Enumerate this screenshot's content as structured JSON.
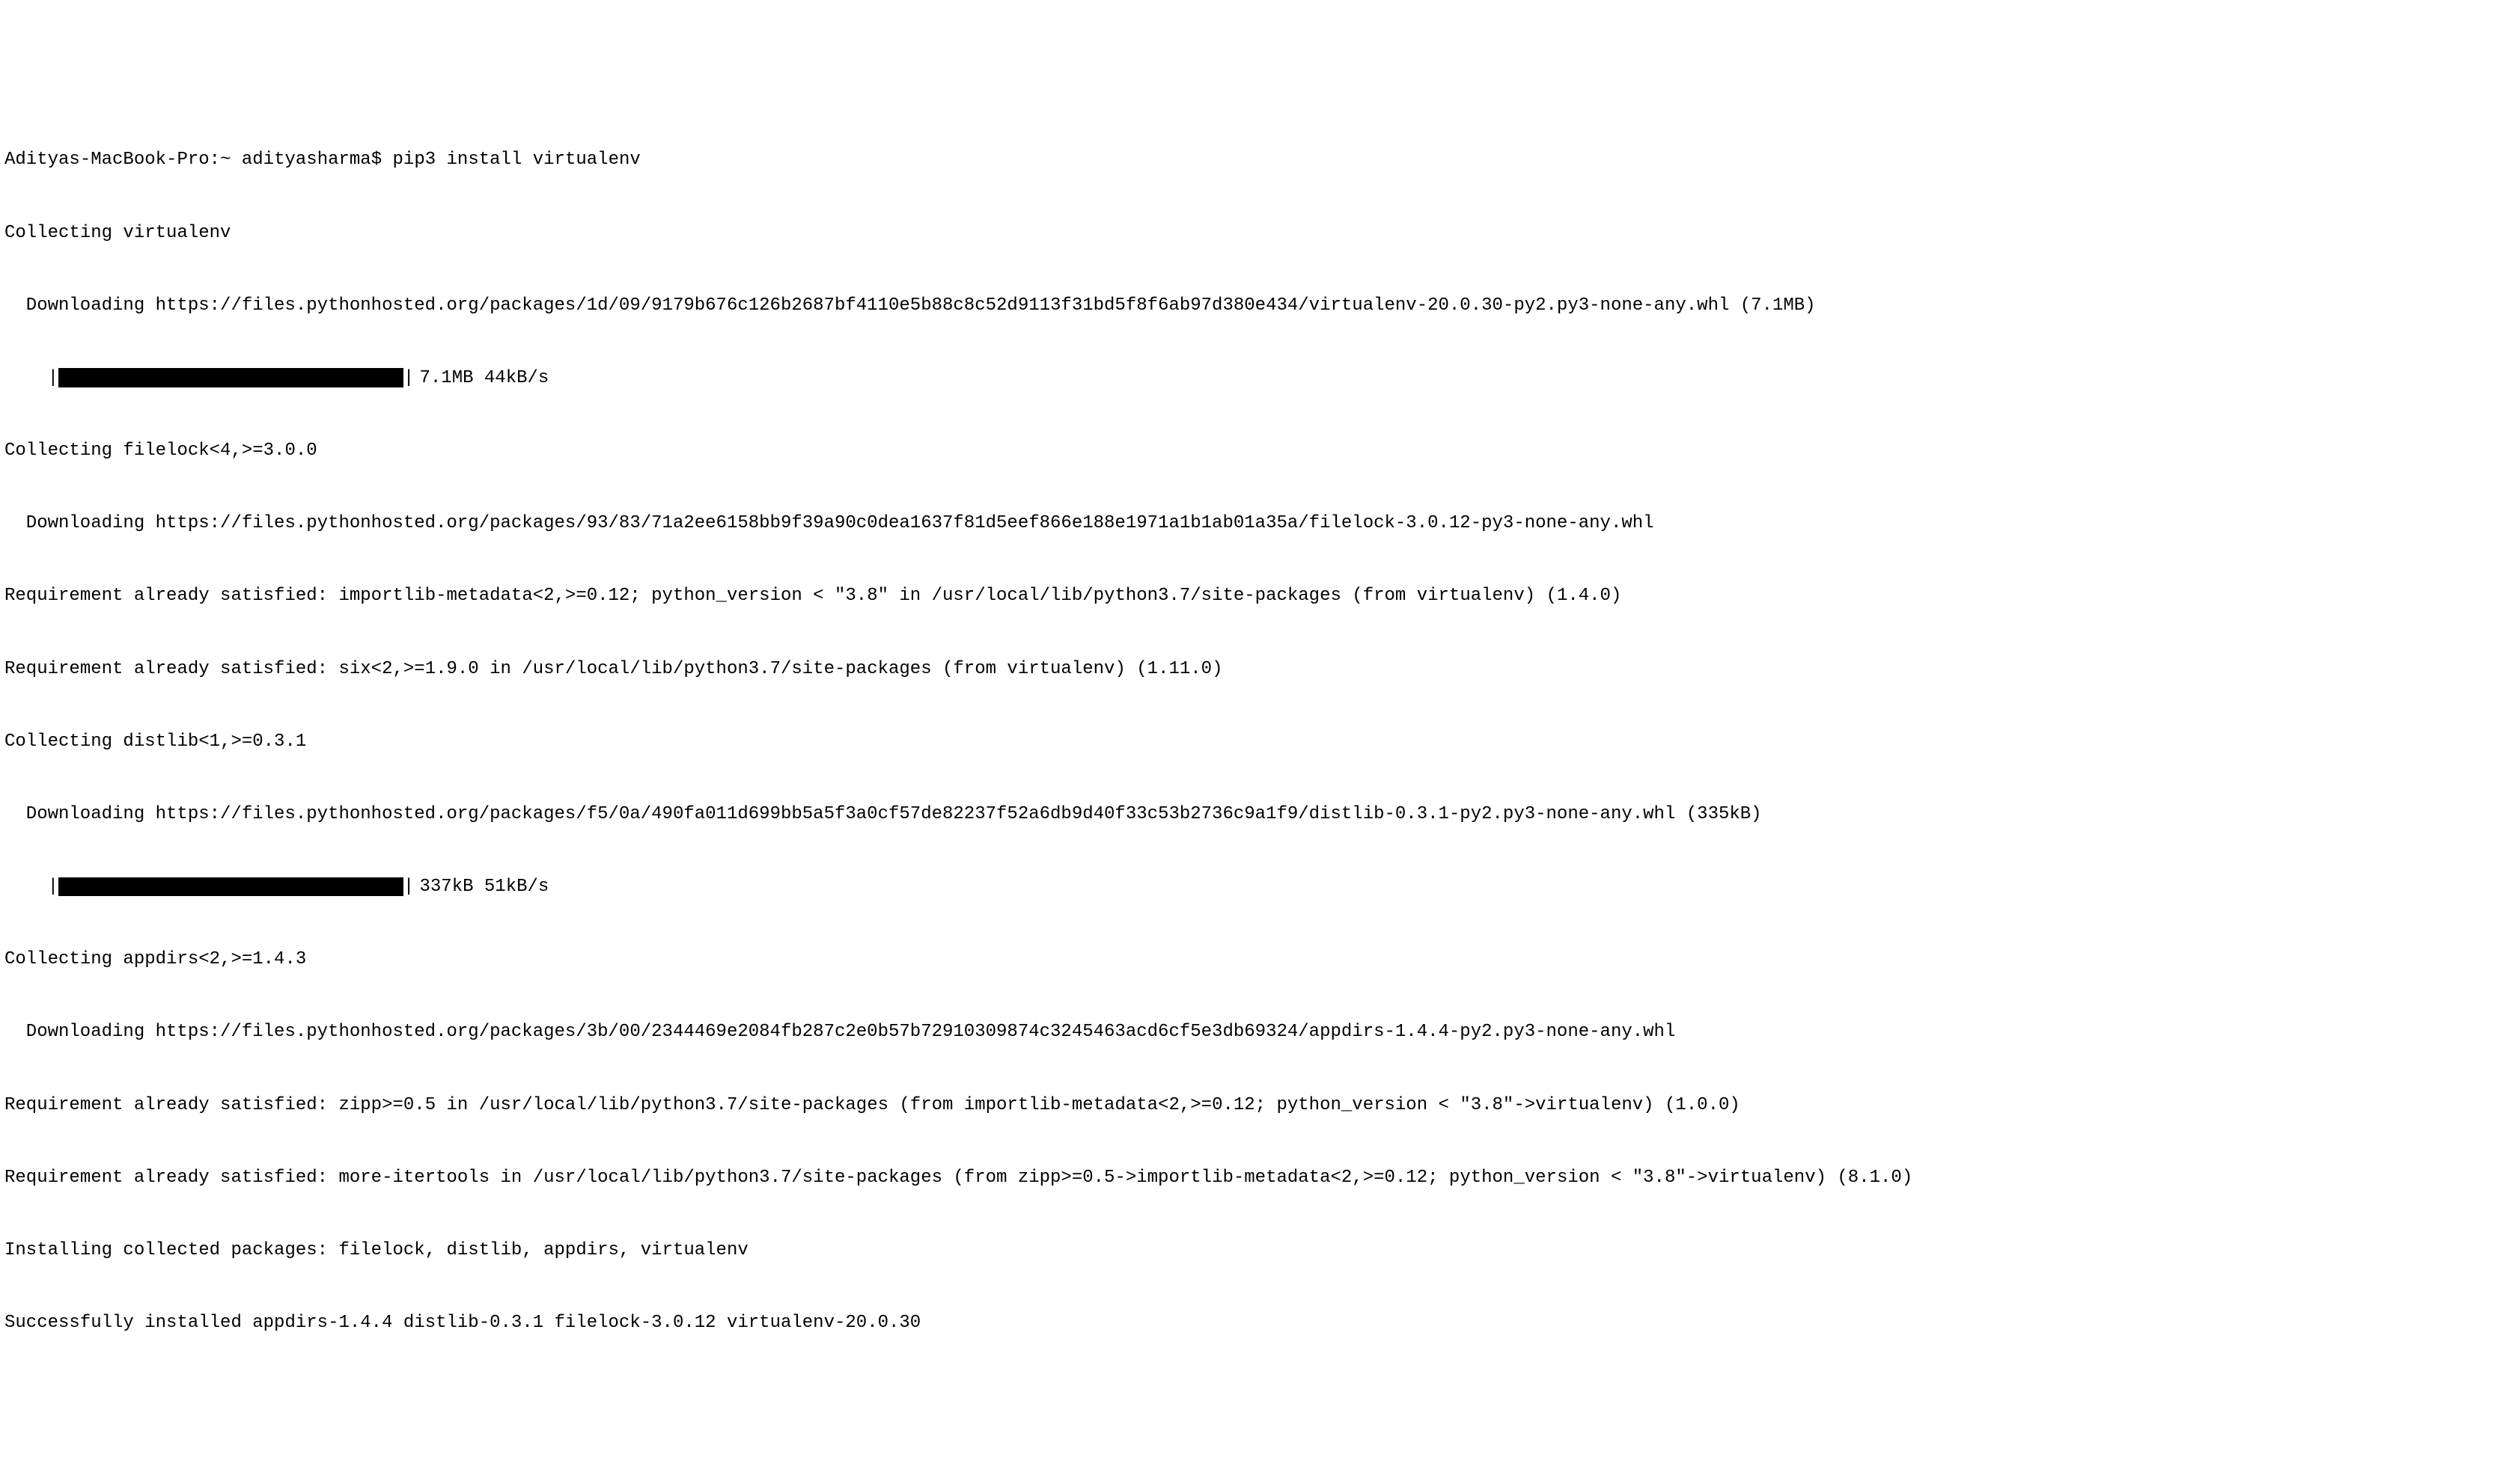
{
  "prompt": {
    "host": "Adityas-MacBook-Pro",
    "path": "~",
    "user": "adityasharma",
    "symbol": "$",
    "command": "pip3 install virtualenv"
  },
  "lines": {
    "l1": "Collecting virtualenv",
    "l2": "Downloading https://files.pythonhosted.org/packages/1d/09/9179b676c126b2687bf4110e5b88c8c52d9113f31bd5f8f6ab97d380e434/virtualenv-20.0.30-py2.py3-none-any.whl (7.1MB)",
    "l4": "Collecting filelock<4,>=3.0.0",
    "l5": "Downloading https://files.pythonhosted.org/packages/93/83/71a2ee6158bb9f39a90c0dea1637f81d5eef866e188e1971a1b1ab01a35a/filelock-3.0.12-py3-none-any.whl",
    "l6": "Requirement already satisfied: importlib-metadata<2,>=0.12; python_version < \"3.8\" in /usr/local/lib/python3.7/site-packages (from virtualenv) (1.4.0)",
    "l7": "Requirement already satisfied: six<2,>=1.9.0 in /usr/local/lib/python3.7/site-packages (from virtualenv) (1.11.0)",
    "l8": "Collecting distlib<1,>=0.3.1",
    "l9": "Downloading https://files.pythonhosted.org/packages/f5/0a/490fa011d699bb5a5f3a0cf57de82237f52a6db9d40f33c53b2736c9a1f9/distlib-0.3.1-py2.py3-none-any.whl (335kB)",
    "l11": "Collecting appdirs<2,>=1.4.3",
    "l12": "Downloading https://files.pythonhosted.org/packages/3b/00/2344469e2084fb287c2e0b57b72910309874c3245463acd6cf5e3db69324/appdirs-1.4.4-py2.py3-none-any.whl",
    "l13": "Requirement already satisfied: zipp>=0.5 in /usr/local/lib/python3.7/site-packages (from importlib-metadata<2,>=0.12; python_version < \"3.8\"->virtualenv) (1.0.0)",
    "l14": "Requirement already satisfied: more-itertools in /usr/local/lib/python3.7/site-packages (from zipp>=0.5->importlib-metadata<2,>=0.12; python_version < \"3.8\"->virtualenv) (8.1.0)",
    "l15": "Installing collected packages: filelock, distlib, appdirs, virtualenv",
    "l16": "Successfully installed appdirs-1.4.4 distlib-0.3.1 filelock-3.0.12 virtualenv-20.0.30"
  },
  "progress": {
    "bar1": {
      "pipe": "|",
      "width_ch": "32",
      "stats": "7.1MB 44kB/s"
    },
    "bar2": {
      "pipe": "|",
      "width_ch": "32",
      "stats": "337kB 51kB/s"
    }
  }
}
